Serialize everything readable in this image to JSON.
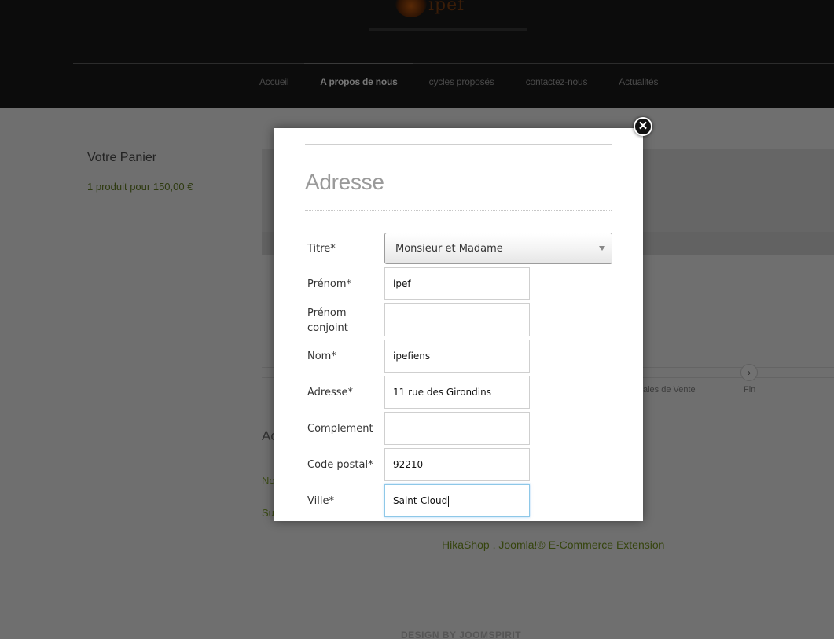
{
  "header": {
    "logo_text": "ipef",
    "nav": [
      "Accueil",
      "A propos de nous",
      "cycles proposés",
      "contactez-nous",
      "Actualités"
    ],
    "active_nav": "A propos de nous"
  },
  "sidebar": {
    "cart_title": "Votre Panier",
    "cart_summary": "1 produit pour 150,00 €"
  },
  "checkout_bg": {
    "step_cgv_fragment": "ales de Vente",
    "step_fin": "Fin",
    "next_step_icon": "chevron-right-icon",
    "heading_fragment": "Ac",
    "line1_fragment": "No",
    "line2_fragment": "Su"
  },
  "footer": {
    "hikashop_link": "HikaShop , Joomla!® E-Commerce Extension",
    "design_credit": "DESIGN BY JOOMSPIRIT"
  },
  "modal": {
    "title": "Adresse",
    "close_icon": "close-icon",
    "fields": {
      "titre": {
        "label": "Titre*",
        "value": "Monsieur et Madame"
      },
      "prenom": {
        "label": "Prénom*",
        "value": "ipef"
      },
      "prenom_conjoint": {
        "label": "Prénom conjoint",
        "value": ""
      },
      "nom": {
        "label": "Nom*",
        "value": "ipefiens"
      },
      "adresse": {
        "label": "Adresse*",
        "value": "11 rue des Girondins"
      },
      "complement": {
        "label": "Complement",
        "value": ""
      },
      "code_postal": {
        "label": "Code postal*",
        "value": "92210"
      },
      "ville": {
        "label": "Ville*",
        "value": "Saint-Cloud"
      }
    }
  }
}
